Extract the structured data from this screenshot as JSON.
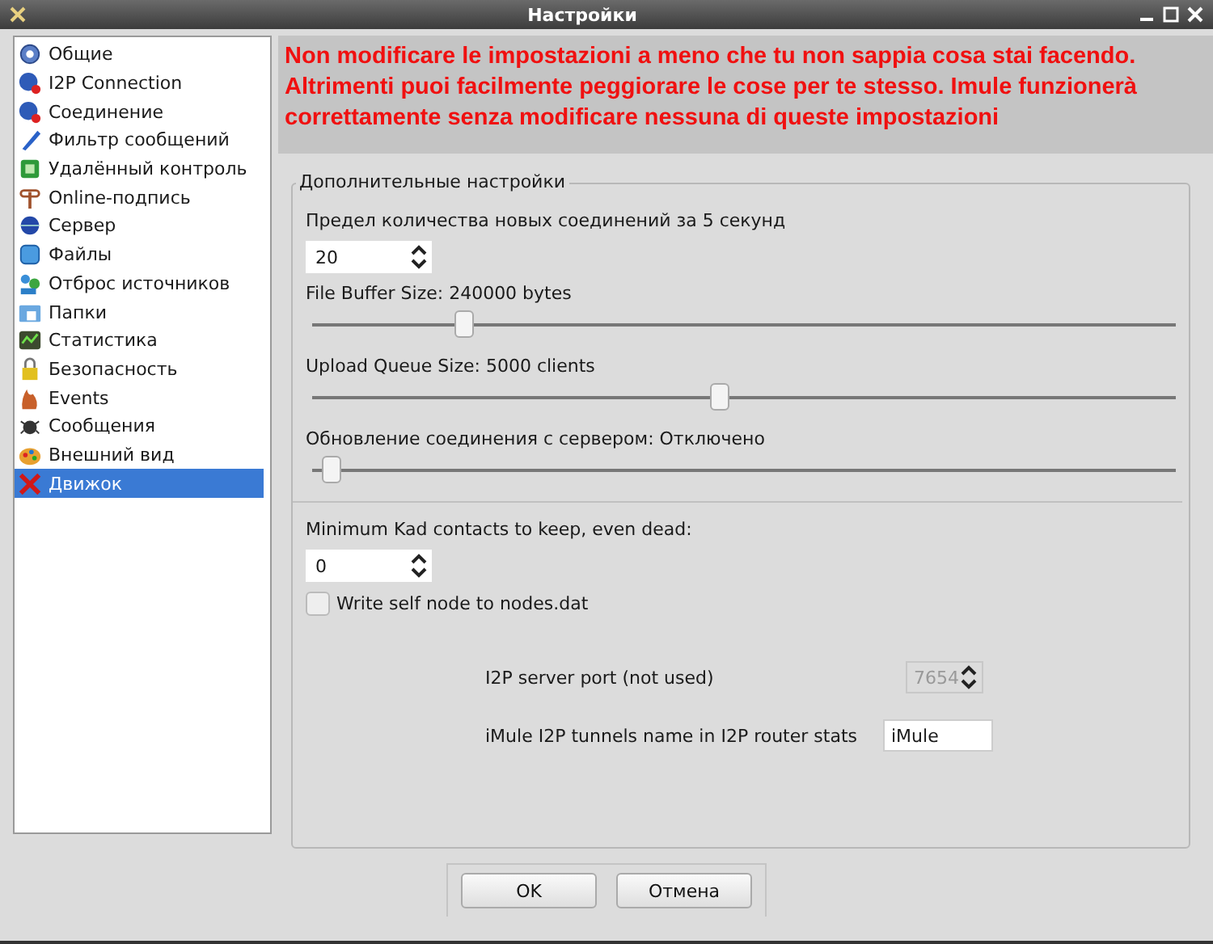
{
  "window": {
    "title": "Настройки"
  },
  "sidebar": {
    "items": [
      {
        "label": "Общие",
        "selected": false
      },
      {
        "label": "I2P Connection",
        "selected": false
      },
      {
        "label": "Соединение",
        "selected": false
      },
      {
        "label": "Фильтр сообщений",
        "selected": false
      },
      {
        "label": "Удалённый контроль",
        "selected": false
      },
      {
        "label": "Online-подпись",
        "selected": false
      },
      {
        "label": "Сервер",
        "selected": false
      },
      {
        "label": "Файлы",
        "selected": false
      },
      {
        "label": "Отброс источников",
        "selected": false
      },
      {
        "label": "Папки",
        "selected": false
      },
      {
        "label": "Статистика",
        "selected": false
      },
      {
        "label": "Безопасность",
        "selected": false
      },
      {
        "label": "Events",
        "selected": false
      },
      {
        "label": "Сообщения",
        "selected": false
      },
      {
        "label": "Внешний вид",
        "selected": false
      },
      {
        "label": "Движок",
        "selected": true
      }
    ]
  },
  "warning": "Non modificare le impostazioni a meno che tu non sappia cosa stai facendo. Altrimenti puoi facilmente peggiorare le cose per te stesso. Imule funzionerà correttamente senza modificare nessuna di queste impostazioni",
  "group": {
    "title": "Дополнительные настройки",
    "controls": [
      {
        "kind": "spin",
        "label": "Предел количества новых соединений за 5 секунд",
        "value": "20"
      },
      {
        "kind": "slider",
        "label": "File Buffer Size: 240000 bytes",
        "level": 0.16
      },
      {
        "kind": "slider",
        "label": "Upload Queue Size: 5000 clients",
        "level": 0.47
      },
      {
        "kind": "slider",
        "label": "Обновление соединения с сервером: Отключено",
        "level": 0.0
      },
      {
        "kind": "separator"
      },
      {
        "kind": "spin",
        "label": "Minimum Kad contacts to keep, even dead:",
        "value": "0"
      },
      {
        "kind": "checkbox",
        "label": "Write self node to nodes.dat",
        "checked": false
      }
    ],
    "i2p": [
      {
        "kind": "spin",
        "label": "I2P server port (not used)",
        "value": "7654",
        "disabled": true
      },
      {
        "kind": "text",
        "label": "iMule I2P tunnels name in I2P router stats",
        "value": "iMule",
        "disabled": false
      }
    ]
  },
  "buttons": [
    "OK",
    "Отмена"
  ]
}
